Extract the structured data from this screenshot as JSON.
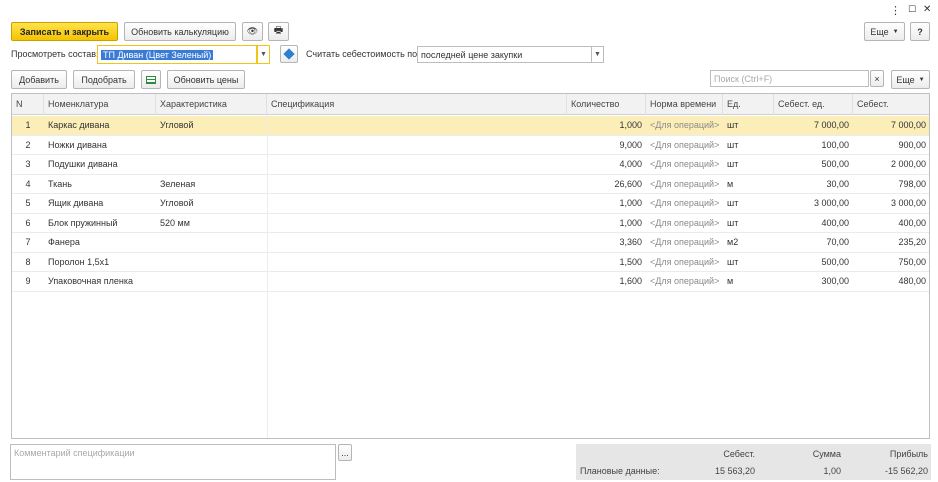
{
  "window_controls": {
    "menu": "⋮",
    "maximize": "☐",
    "close": "✕"
  },
  "toolbar": {
    "save_close": "Записать и закрыть",
    "refresh_calc": "Обновить калькуляцию",
    "eye_icon": "👁",
    "print_icon": "🖶",
    "more": "Еще",
    "help": "?"
  },
  "filters": {
    "view_label": "Просмотреть состав:",
    "view_value": "ТП Диван (Цвет Зеленый)",
    "cost_label": "Считать себестоимость по:",
    "cost_value": "последней цене закупки"
  },
  "table_toolbar": {
    "add": "Добавить",
    "pick": "Подобрать",
    "update_prices": "Обновить цены",
    "search_placeholder": "Поиск (Ctrl+F)",
    "search_clear": "×",
    "more": "Еще"
  },
  "columns": [
    "N",
    "Номенклатура",
    "Характеристика",
    "Спецификация",
    "Количество",
    "Норма времени",
    "Ед.",
    "Себест. ед.",
    "Себест."
  ],
  "rows": [
    {
      "n": "1",
      "name": "Каркас дивана",
      "char": "Угловой",
      "spec": "",
      "qty": "1,000",
      "norm": "<Для операций>",
      "unit": "шт",
      "unit_cost": "7 000,00",
      "cost": "7 000,00"
    },
    {
      "n": "2",
      "name": "Ножки дивана",
      "char": "",
      "spec": "",
      "qty": "9,000",
      "norm": "<Для операций>",
      "unit": "шт",
      "unit_cost": "100,00",
      "cost": "900,00"
    },
    {
      "n": "3",
      "name": "Подушки дивана",
      "char": "",
      "spec": "",
      "qty": "4,000",
      "norm": "<Для операций>",
      "unit": "шт",
      "unit_cost": "500,00",
      "cost": "2 000,00"
    },
    {
      "n": "4",
      "name": "Ткань",
      "char": "Зеленая",
      "spec": "",
      "qty": "26,600",
      "norm": "<Для операций>",
      "unit": "м",
      "unit_cost": "30,00",
      "cost": "798,00"
    },
    {
      "n": "5",
      "name": "Ящик дивана",
      "char": "Угловой",
      "spec": "",
      "qty": "1,000",
      "norm": "<Для операций>",
      "unit": "шт",
      "unit_cost": "3 000,00",
      "cost": "3 000,00"
    },
    {
      "n": "6",
      "name": "Блок пружинный",
      "char": "520 мм",
      "spec": "",
      "qty": "1,000",
      "norm": "<Для операций>",
      "unit": "шт",
      "unit_cost": "400,00",
      "cost": "400,00"
    },
    {
      "n": "7",
      "name": "Фанера",
      "char": "",
      "spec": "",
      "qty": "3,360",
      "norm": "<Для операций>",
      "unit": "м2",
      "unit_cost": "70,00",
      "cost": "235,20"
    },
    {
      "n": "8",
      "name": "Поролон 1,5х1",
      "char": "",
      "spec": "",
      "qty": "1,500",
      "norm": "<Для операций>",
      "unit": "шт",
      "unit_cost": "500,00",
      "cost": "750,00"
    },
    {
      "n": "9",
      "name": "Упаковочная пленка",
      "char": "",
      "spec": "",
      "qty": "1,600",
      "norm": "<Для операций>",
      "unit": "м",
      "unit_cost": "300,00",
      "cost": "480,00"
    }
  ],
  "comment": {
    "placeholder": "Комментарий спецификации",
    "button": "..."
  },
  "totals": {
    "h_cost": "Себест.",
    "h_sum": "Сумма",
    "h_profit": "Прибыль",
    "row_label": "Плановые данные:",
    "cost": "15 563,20",
    "sum": "1,00",
    "profit": "-15 562,20"
  },
  "colors": {
    "primary": "#f5c400",
    "selected_row": "#fbeeb9",
    "focus_border": "#f0c419"
  }
}
